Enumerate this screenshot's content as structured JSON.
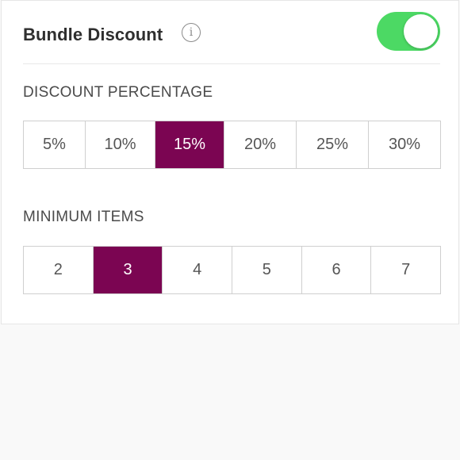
{
  "header": {
    "title": "Bundle Discount",
    "info_icon": "i",
    "toggle_on": true,
    "toggle_color": "#4cd964"
  },
  "discount": {
    "label": "DISCOUNT PERCENTAGE",
    "options": [
      "5%",
      "10%",
      "15%",
      "20%",
      "25%",
      "30%"
    ],
    "selected": "15%"
  },
  "minimum_items": {
    "label": "MINIMUM ITEMS",
    "options": [
      "2",
      "3",
      "4",
      "5",
      "6",
      "7"
    ],
    "selected": "3"
  },
  "colors": {
    "selected_bg": "#7b0552",
    "toggle_on": "#4cd964"
  }
}
